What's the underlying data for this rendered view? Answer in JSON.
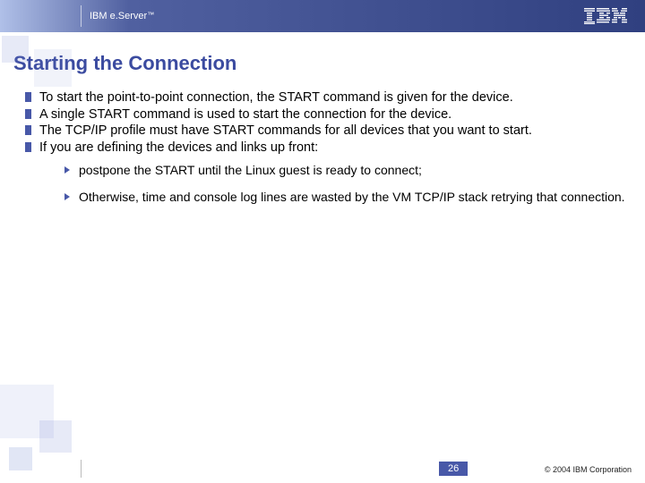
{
  "header": {
    "brand_prefix": "IBM e.Server",
    "tm": "™",
    "logo_label": "IBM"
  },
  "title": "Starting the Connection",
  "bullets": [
    "To start the point-to-point connection, the START command is given for the device.",
    "A single START command is used to start the connection for the device.",
    "The TCP/IP profile must have START commands for all devices that you want to start.",
    "If you are defining the devices and links up front:"
  ],
  "sub_bullets": [
    "postpone the START until the Linux guest is ready to connect;",
    "Otherwise, time and console log lines are wasted by the VM TCP/IP stack retrying that connection."
  ],
  "footer": {
    "page": "26",
    "copyright": "© 2004 IBM Corporation"
  }
}
